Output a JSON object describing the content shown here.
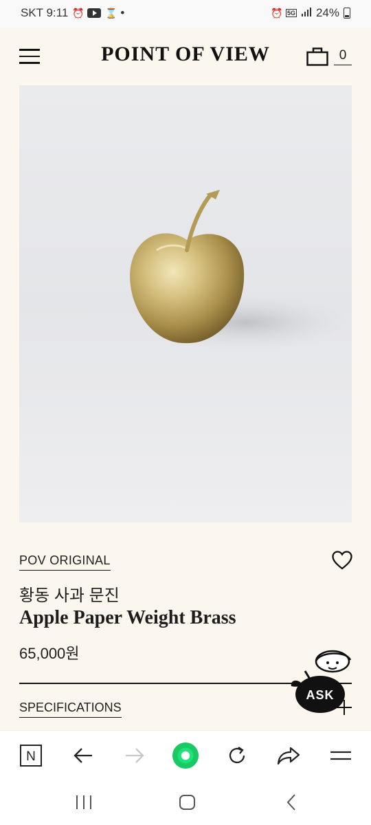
{
  "status_bar": {
    "carrier_time": "SKT 9:11",
    "dot": "•",
    "network": "5G",
    "battery": "24%"
  },
  "header": {
    "brand": "POINT OF VIEW",
    "cart_count": "0"
  },
  "product": {
    "brand_tag": "POV ORIGINAL",
    "name_ko": "황동 사과 문진",
    "name_en": "Apple Paper Weight Brass",
    "price": "65,000원",
    "specifications_label": "SPECIFICATIONS"
  },
  "ask_badge": {
    "label": "ASK"
  },
  "browser_bar": {
    "items": [
      "naver-home",
      "back",
      "forward",
      "green-dot",
      "refresh",
      "share",
      "menu"
    ],
    "home_letter": "N"
  },
  "colors": {
    "background": "#fbf6ee",
    "text": "#1d1d1d",
    "accent_green": "#18c964",
    "disabled": "#c8c8c8"
  }
}
